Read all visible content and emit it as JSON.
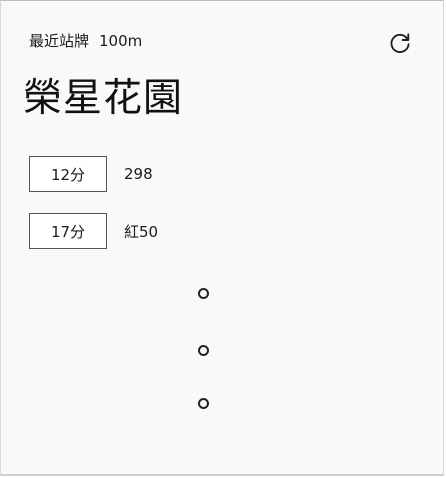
{
  "header": {
    "label": "最近站牌",
    "distance": "100m",
    "refresh_icon": "refresh-icon"
  },
  "stop_name": "榮星花園",
  "arrivals": [
    {
      "eta": "12分",
      "route": "298"
    },
    {
      "eta": "17分",
      "route": "紅50"
    }
  ],
  "loading_indicator_icon": "ellipsis-vertical-icon"
}
